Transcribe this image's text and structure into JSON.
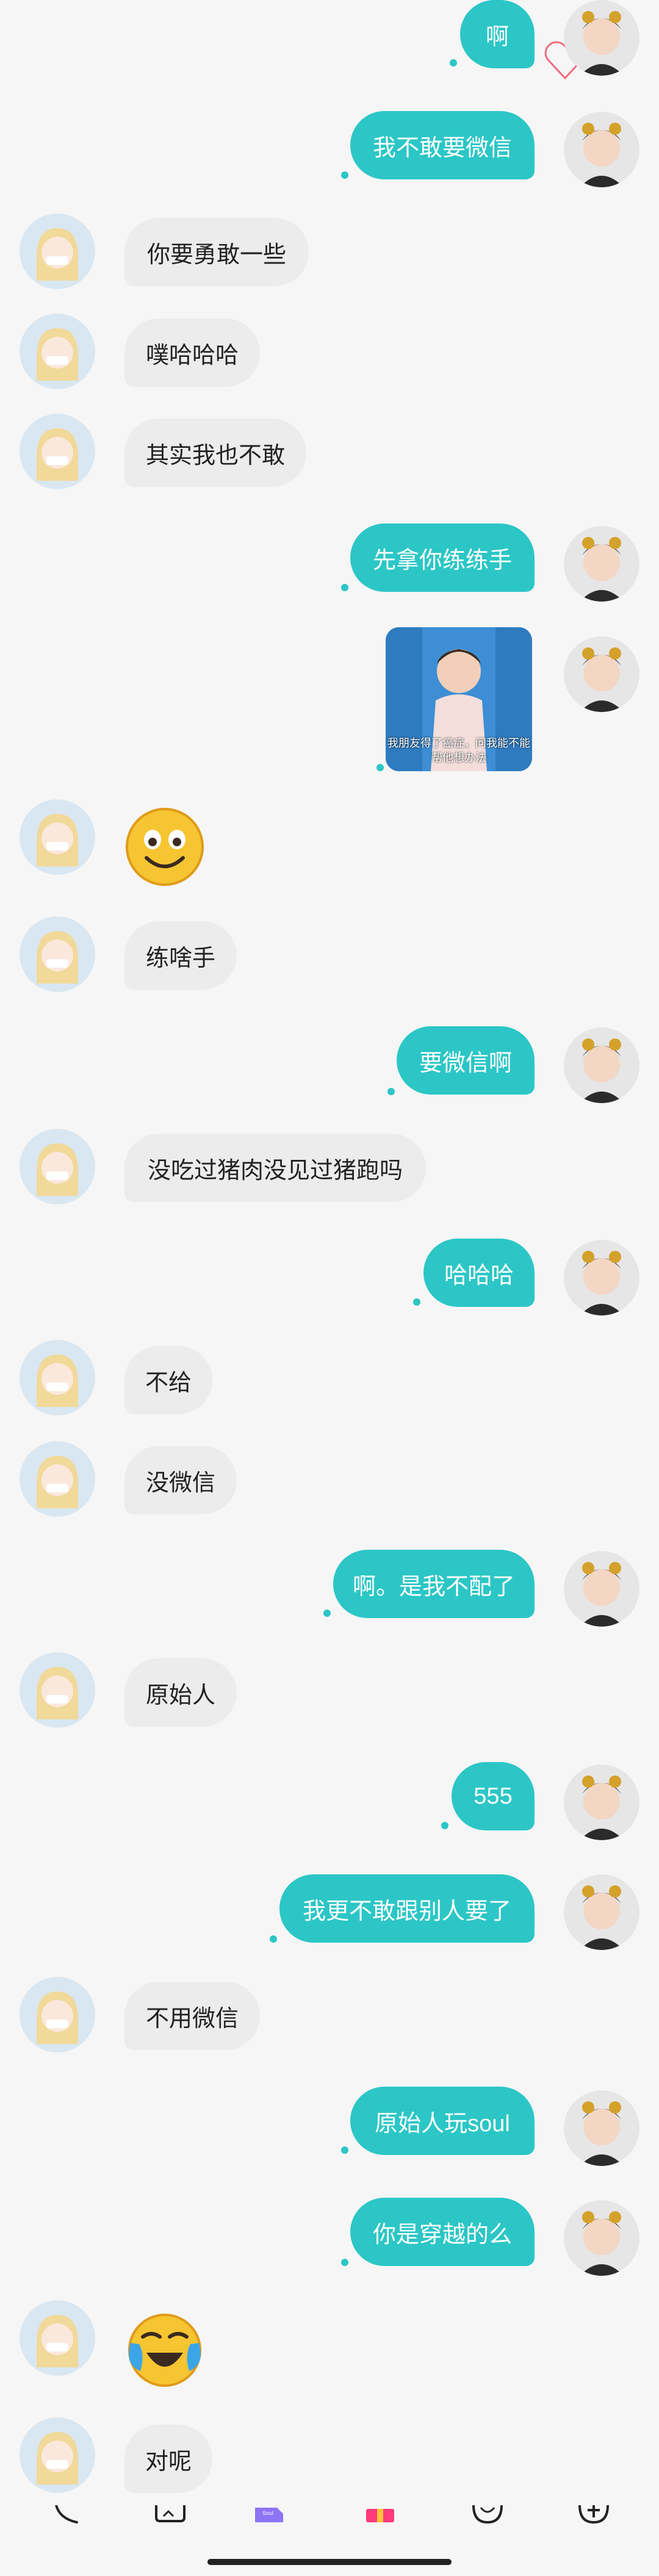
{
  "messages": [
    {
      "side": "right",
      "text": "啊"
    },
    {
      "side": "right",
      "text": "我不敢要微信"
    },
    {
      "side": "left",
      "text": "你要勇敢一些"
    },
    {
      "side": "left",
      "text": "噗哈哈哈"
    },
    {
      "side": "left",
      "text": "其实我也不敢"
    },
    {
      "side": "right",
      "text": "先拿你练练手"
    },
    {
      "side": "right",
      "type": "image",
      "caption": "我朋友得了癌症，问我能不能帮他想办法"
    },
    {
      "side": "left",
      "type": "emoji",
      "emoji": "smile-emoji"
    },
    {
      "side": "left",
      "text": "练啥手"
    },
    {
      "side": "right",
      "text": "要微信啊"
    },
    {
      "side": "left",
      "text": "没吃过猪肉没见过猪跑吗"
    },
    {
      "side": "right",
      "text": "哈哈哈"
    },
    {
      "side": "left",
      "text": "不给"
    },
    {
      "side": "left",
      "text": "没微信"
    },
    {
      "side": "right",
      "text": "啊。是我不配了"
    },
    {
      "side": "left",
      "text": "原始人"
    },
    {
      "side": "right",
      "text": "555"
    },
    {
      "side": "right",
      "text": "我更不敢跟别人要了"
    },
    {
      "side": "left",
      "text": "不用微信"
    },
    {
      "side": "right",
      "text": "原始人玩soul"
    },
    {
      "side": "right",
      "text": "你是穿越的么"
    },
    {
      "side": "left",
      "type": "emoji",
      "emoji": "crying-laughing-emoji"
    },
    {
      "side": "left",
      "text": "对呢"
    }
  ],
  "bottom_bar": {
    "icons": [
      "phone-icon",
      "image-icon",
      "gift-box-icon",
      "present-icon",
      "sticker-icon",
      "plus-icon"
    ]
  },
  "colors": {
    "accent": "#2cc6c6",
    "left_bubble": "#ececec",
    "background": "#f6f6f6"
  }
}
